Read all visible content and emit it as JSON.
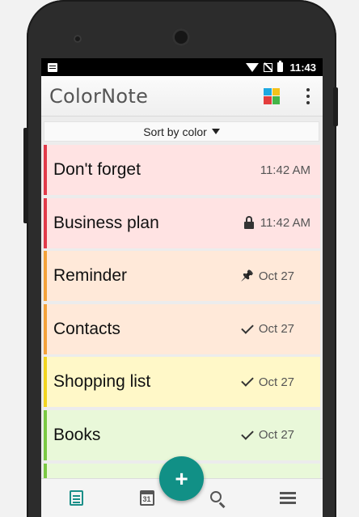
{
  "status_bar": {
    "time": "11:43",
    "icons": [
      "notification-icon",
      "wifi-icon",
      "no-signal-icon",
      "battery-icon"
    ]
  },
  "app_bar": {
    "logo_text": "ColorNote",
    "palette_icon": "color-palette-icon",
    "palette_colors": [
      "#1fa9e1",
      "#f4c21b",
      "#e43d3d",
      "#44b548"
    ],
    "more_icon": "more-vert-icon"
  },
  "sort": {
    "label": "Sort by color"
  },
  "notes": [
    {
      "title": "Don't forget",
      "meta": "11:42 AM",
      "icon": "",
      "bg": "#ffe3e3",
      "stripe": "#e13a4a"
    },
    {
      "title": "Business plan",
      "meta": "11:42 AM",
      "icon": "lock-icon",
      "bg": "#ffe3e3",
      "stripe": "#e13a4a"
    },
    {
      "title": "Reminder",
      "meta": "Oct 27",
      "icon": "pin-icon",
      "bg": "#ffe9d9",
      "stripe": "#f4a23a"
    },
    {
      "title": "Contacts",
      "meta": "Oct 27",
      "icon": "check-icon",
      "bg": "#ffe9d9",
      "stripe": "#f4a23a"
    },
    {
      "title": "Shopping list",
      "meta": "Oct 27",
      "icon": "check-icon",
      "bg": "#fff8c8",
      "stripe": "#f2d41f"
    },
    {
      "title": "Books",
      "meta": "Oct 27",
      "icon": "check-icon",
      "bg": "#e9f8d9",
      "stripe": "#7ac943"
    },
    {
      "title": "",
      "meta": "",
      "icon": "",
      "bg": "#e9f8d9",
      "stripe": "#7ac943"
    }
  ],
  "bottom_nav": {
    "items": [
      {
        "name": "notes-list-icon",
        "active": true
      },
      {
        "name": "calendar-icon",
        "label": "31"
      },
      {
        "name": "search-icon"
      },
      {
        "name": "menu-icon"
      }
    ]
  },
  "fab": {
    "label": "+"
  },
  "colors": {
    "accent": "#119086"
  }
}
